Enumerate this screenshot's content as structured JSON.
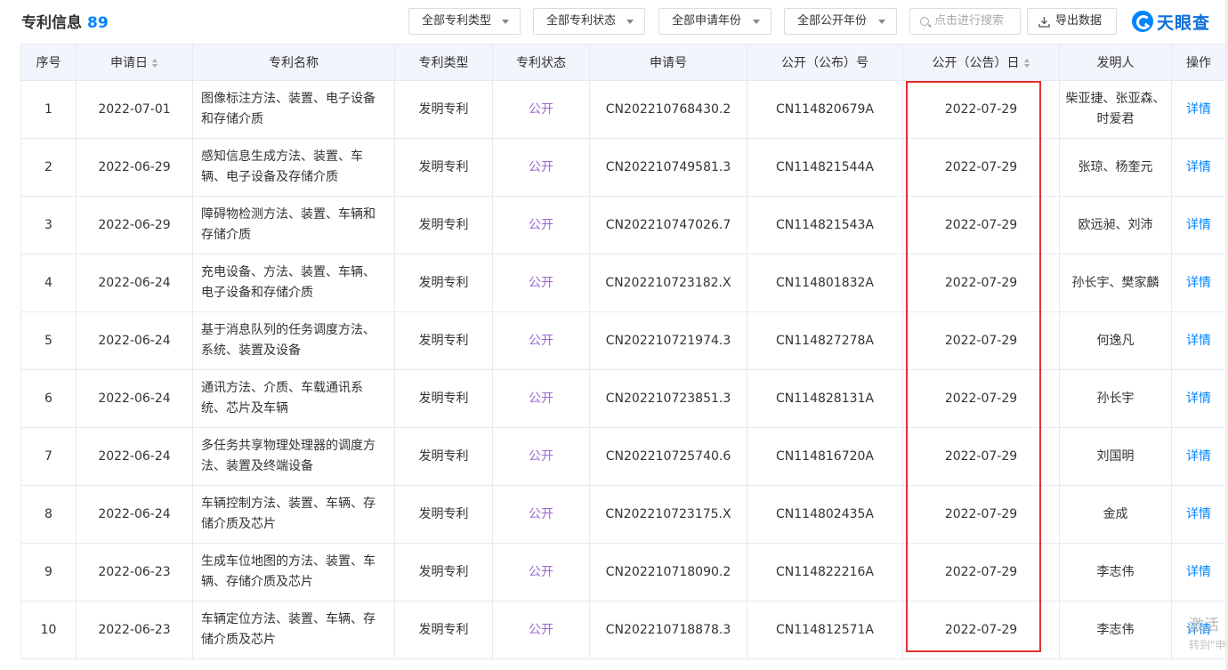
{
  "header": {
    "title": "专利信息",
    "count": "89",
    "filters": [
      {
        "label": "全部专利类型"
      },
      {
        "label": "全部专利状态"
      },
      {
        "label": "全部申请年份"
      },
      {
        "label": "全部公开年份"
      }
    ],
    "search_placeholder": "点击进行搜索",
    "export_label": "导出数据",
    "logo_text": "天眼查"
  },
  "table": {
    "columns": [
      "序号",
      "申请日",
      "专利名称",
      "专利类型",
      "专利状态",
      "申请号",
      "公开（公布）号",
      "公开（公告）日",
      "发明人",
      "操作"
    ],
    "rows": [
      {
        "no": "1",
        "date": "2022-07-01",
        "name": "图像标注方法、装置、电子设备和存储介质",
        "type": "发明专利",
        "status": "公开",
        "app_no": "CN202210768430.2",
        "pub_no": "CN114820679A",
        "pub_date": "2022-07-29",
        "inventor": "柴亚捷、张亚森、时爱君",
        "action": "详情"
      },
      {
        "no": "2",
        "date": "2022-06-29",
        "name": "感知信息生成方法、装置、车辆、电子设备及存储介质",
        "type": "发明专利",
        "status": "公开",
        "app_no": "CN202210749581.3",
        "pub_no": "CN114821544A",
        "pub_date": "2022-07-29",
        "inventor": "张琼、杨奎元",
        "action": "详情"
      },
      {
        "no": "3",
        "date": "2022-06-29",
        "name": "障碍物检测方法、装置、车辆和存储介质",
        "type": "发明专利",
        "status": "公开",
        "app_no": "CN202210747026.7",
        "pub_no": "CN114821543A",
        "pub_date": "2022-07-29",
        "inventor": "欧远昶、刘沛",
        "action": "详情"
      },
      {
        "no": "4",
        "date": "2022-06-24",
        "name": "充电设备、方法、装置、车辆、电子设备和存储介质",
        "type": "发明专利",
        "status": "公开",
        "app_no": "CN202210723182.X",
        "pub_no": "CN114801832A",
        "pub_date": "2022-07-29",
        "inventor": "孙长宇、樊家麟",
        "action": "详情"
      },
      {
        "no": "5",
        "date": "2022-06-24",
        "name": "基于消息队列的任务调度方法、系统、装置及设备",
        "type": "发明专利",
        "status": "公开",
        "app_no": "CN202210721974.3",
        "pub_no": "CN114827278A",
        "pub_date": "2022-07-29",
        "inventor": "何逸凡",
        "action": "详情"
      },
      {
        "no": "6",
        "date": "2022-06-24",
        "name": "通讯方法、介质、车载通讯系统、芯片及车辆",
        "type": "发明专利",
        "status": "公开",
        "app_no": "CN202210723851.3",
        "pub_no": "CN114828131A",
        "pub_date": "2022-07-29",
        "inventor": "孙长宇",
        "action": "详情"
      },
      {
        "no": "7",
        "date": "2022-06-24",
        "name": "多任务共享物理处理器的调度方法、装置及终端设备",
        "type": "发明专利",
        "status": "公开",
        "app_no": "CN202210725740.6",
        "pub_no": "CN114816720A",
        "pub_date": "2022-07-29",
        "inventor": "刘国明",
        "action": "详情"
      },
      {
        "no": "8",
        "date": "2022-06-24",
        "name": "车辆控制方法、装置、车辆、存储介质及芯片",
        "type": "发明专利",
        "status": "公开",
        "app_no": "CN202210723175.X",
        "pub_no": "CN114802435A",
        "pub_date": "2022-07-29",
        "inventor": "金成",
        "action": "详情"
      },
      {
        "no": "9",
        "date": "2022-06-23",
        "name": "生成车位地图的方法、装置、车辆、存储介质及芯片",
        "type": "发明专利",
        "status": "公开",
        "app_no": "CN202210718090.2",
        "pub_no": "CN114822216A",
        "pub_date": "2022-07-29",
        "inventor": "李志伟",
        "action": "详情"
      },
      {
        "no": "10",
        "date": "2022-06-23",
        "name": "车辆定位方法、装置、车辆、存储介质及芯片",
        "type": "发明专利",
        "status": "公开",
        "app_no": "CN202210718878.3",
        "pub_no": "CN114812571A",
        "pub_date": "2022-07-29",
        "inventor": "李志伟",
        "action": "详情"
      }
    ]
  },
  "colors": {
    "accent": "#0084ff",
    "status": "#9b6ad1",
    "highlight": "#e03131",
    "header_bg": "#f2f5fc"
  },
  "watermark": {
    "line1": "激活",
    "line2": "转到\"申"
  }
}
